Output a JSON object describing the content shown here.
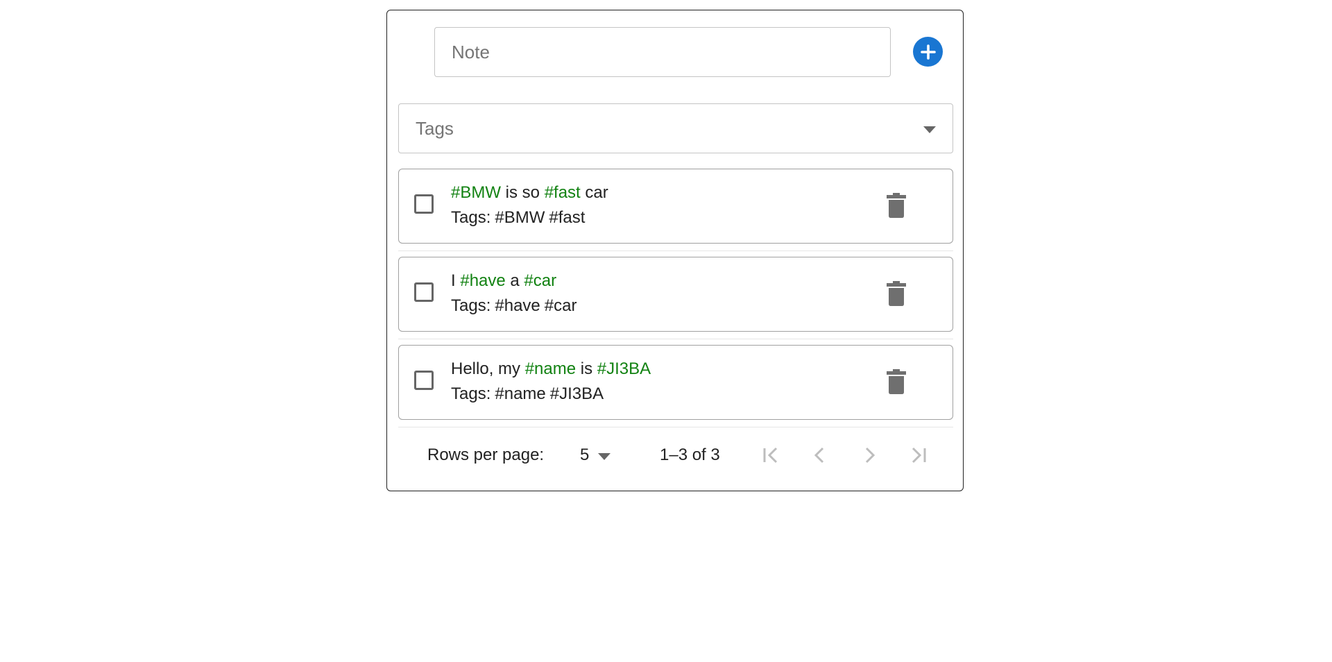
{
  "composer": {
    "note_placeholder": "Note",
    "add_icon": "plus-icon"
  },
  "tags_filter": {
    "label": "Tags",
    "arrow_icon": "dropdown-arrow-icon"
  },
  "colors": {
    "accent": "#1976d2",
    "hashtag": "#128212",
    "icon_gray": "#6f6f6f",
    "disabled": "#bdbdbd"
  },
  "notes": [
    {
      "text_parts": [
        {
          "text": "#BMW",
          "tag": true
        },
        {
          "text": " is so ",
          "tag": false
        },
        {
          "text": "#fast",
          "tag": true
        },
        {
          "text": " car",
          "tag": false
        }
      ],
      "tags_label": "Tags:",
      "tags": [
        "#BMW",
        "#fast"
      ],
      "checked": false
    },
    {
      "text_parts": [
        {
          "text": "I ",
          "tag": false
        },
        {
          "text": "#have",
          "tag": true
        },
        {
          "text": " a ",
          "tag": false
        },
        {
          "text": "#car",
          "tag": true
        }
      ],
      "tags_label": "Tags:",
      "tags": [
        "#have",
        "#car"
      ],
      "checked": false
    },
    {
      "text_parts": [
        {
          "text": "Hello, my ",
          "tag": false
        },
        {
          "text": "#name",
          "tag": true
        },
        {
          "text": " is ",
          "tag": false
        },
        {
          "text": "#JI3BA",
          "tag": true
        }
      ],
      "tags_label": "Tags:",
      "tags": [
        "#name",
        "#JI3BA"
      ],
      "checked": false
    }
  ],
  "pagination": {
    "rows_per_page_label": "Rows per page:",
    "rows_per_page_value": "5",
    "range_text": "1–3 of 3",
    "first_icon": "first-page-icon",
    "prev_icon": "chevron-left-icon",
    "next_icon": "chevron-right-icon",
    "last_icon": "last-page-icon"
  }
}
